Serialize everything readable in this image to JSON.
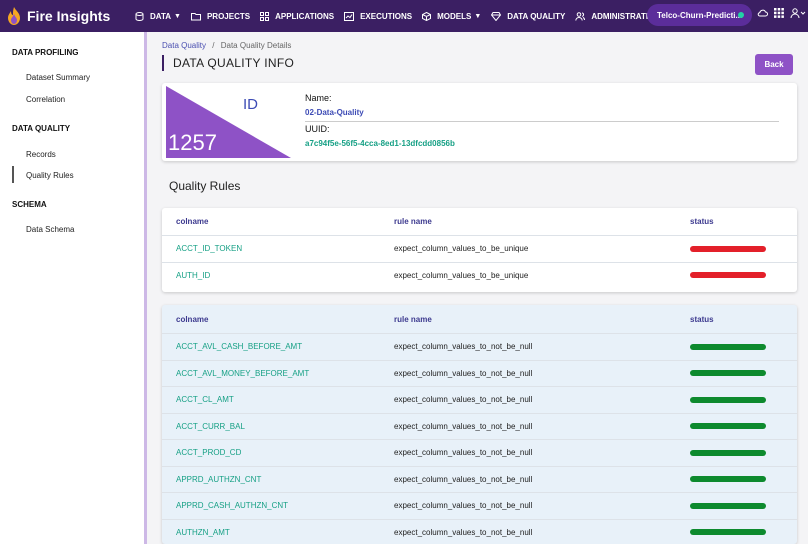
{
  "app": {
    "title": "Fire Insights"
  },
  "nav": {
    "items": [
      {
        "label": "DATA",
        "icon": "database-icon",
        "has_caret": true
      },
      {
        "label": "PROJECTS",
        "icon": "folder-icon",
        "has_caret": false
      },
      {
        "label": "APPLICATIONS",
        "icon": "grid-icon",
        "has_caret": false
      },
      {
        "label": "EXECUTIONS",
        "icon": "chart-icon",
        "has_caret": false
      },
      {
        "label": "MODELS",
        "icon": "cube-icon",
        "has_caret": true
      },
      {
        "label": "DATA QUALITY",
        "icon": "diamond-icon",
        "has_caret": false
      },
      {
        "label": "ADMINISTRATION",
        "icon": "users-icon",
        "has_caret": false
      }
    ],
    "project": "Telco-Churn-Predicti...",
    "project_status_color": "#22d3a5"
  },
  "sidebar": {
    "sections": [
      {
        "title": "DATA PROFILING",
        "items": [
          "Dataset Summary",
          "Correlation"
        ]
      },
      {
        "title": "DATA QUALITY",
        "items": [
          "Records",
          "Quality Rules"
        ]
      },
      {
        "title": "SCHEMA",
        "items": [
          "Data Schema"
        ]
      }
    ],
    "active_item": "Quality Rules"
  },
  "breadcrumb": {
    "parent": "Data Quality",
    "separator": "/",
    "current": "Data Quality Details"
  },
  "page": {
    "title": "DATA QUALITY INFO",
    "back_label": "Back"
  },
  "info": {
    "id_label": "ID",
    "id_value": "1257",
    "name_label": "Name:",
    "name_value": "02-Data-Quality",
    "uuid_label": "UUID:",
    "uuid_value": "a7c94f5e-56f5-4cca-8ed1-13dfcdd0856b"
  },
  "quality_rules": {
    "heading": "Quality Rules",
    "columns": {
      "colname": "colname",
      "rule": "rule name",
      "status": "status"
    },
    "failed": [
      {
        "colname": "ACCT_ID_TOKEN",
        "rule": "expect_column_values_to_be_unique",
        "status": "fail"
      },
      {
        "colname": "AUTH_ID",
        "rule": "expect_column_values_to_be_unique",
        "status": "fail"
      }
    ],
    "passed": [
      {
        "colname": "ACCT_AVL_CASH_BEFORE_AMT",
        "rule": "expect_column_values_to_not_be_null",
        "status": "pass"
      },
      {
        "colname": "ACCT_AVL_MONEY_BEFORE_AMT",
        "rule": "expect_column_values_to_not_be_null",
        "status": "pass"
      },
      {
        "colname": "ACCT_CL_AMT",
        "rule": "expect_column_values_to_not_be_null",
        "status": "pass"
      },
      {
        "colname": "ACCT_CURR_BAL",
        "rule": "expect_column_values_to_not_be_null",
        "status": "pass"
      },
      {
        "colname": "ACCT_PROD_CD",
        "rule": "expect_column_values_to_not_be_null",
        "status": "pass"
      },
      {
        "colname": "APPRD_AUTHZN_CNT",
        "rule": "expect_column_values_to_not_be_null",
        "status": "pass"
      },
      {
        "colname": "APPRD_CASH_AUTHZN_CNT",
        "rule": "expect_column_values_to_not_be_null",
        "status": "pass"
      },
      {
        "colname": "AUTHZN_AMT",
        "rule": "expect_column_values_to_not_be_null",
        "status": "pass"
      }
    ],
    "colors": {
      "fail": "#e3202a",
      "pass": "#0d8a2e"
    }
  },
  "colors": {
    "nav_bg": "#3b1f63",
    "accent": "#8e52c6",
    "link": "#16a085"
  }
}
